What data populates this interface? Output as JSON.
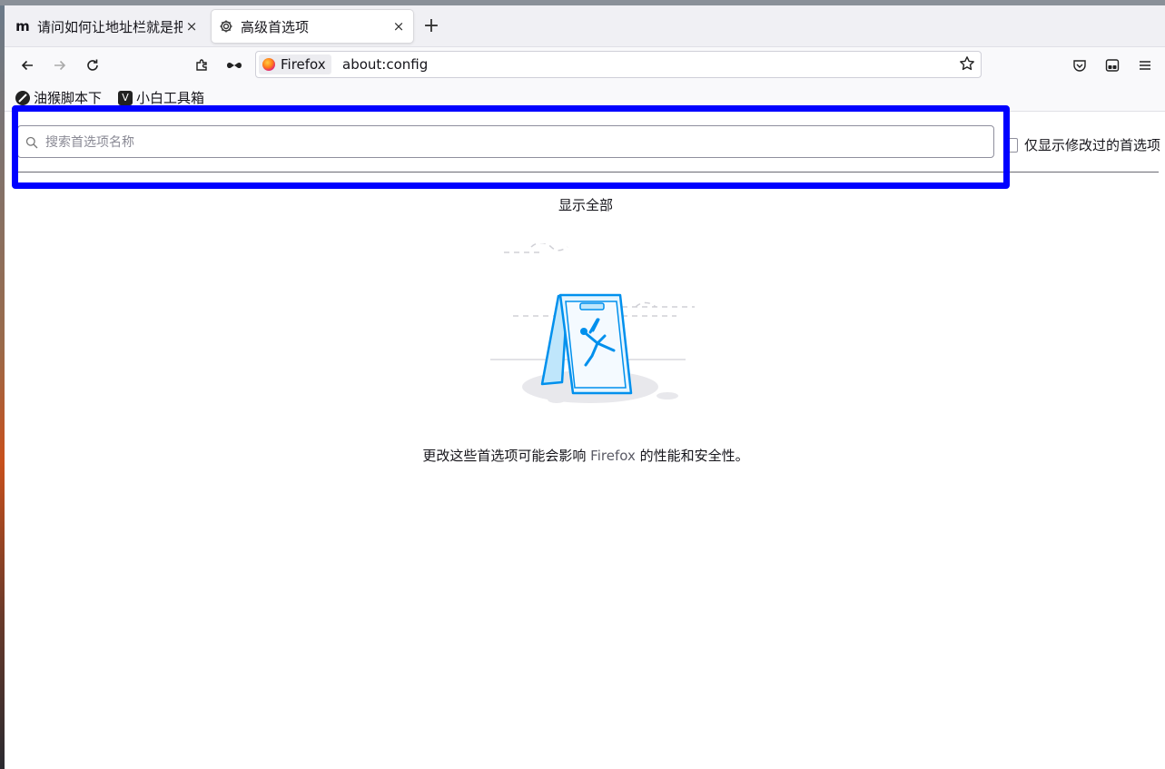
{
  "tabs": [
    {
      "favicon": "m",
      "label": "请问如何让地址栏就是把",
      "active": false
    },
    {
      "favicon": "gear-icon",
      "label": "高级首选项",
      "active": true
    }
  ],
  "newtab_icon": "+",
  "close_icon": "×",
  "urlbar": {
    "identity_label": "Firefox",
    "url": "about:config"
  },
  "bookmarks": [
    {
      "icon": "monkey-icon",
      "label": "油猴脚本下"
    },
    {
      "icon": "v-icon",
      "icon_text": "V",
      "label": "小白工具箱"
    }
  ],
  "config": {
    "search_placeholder": "搜索首选项名称",
    "modified_only_label": "仅显示修改过的首选项",
    "show_all": "显示全部",
    "warning_prefix": "更改这些首选项可能会影响 ",
    "warning_brand": "Firefox",
    "warning_suffix": " 的性能和安全性。"
  },
  "colors": {
    "highlight": "#0000ff",
    "illustration_blue": "#0090ed"
  }
}
